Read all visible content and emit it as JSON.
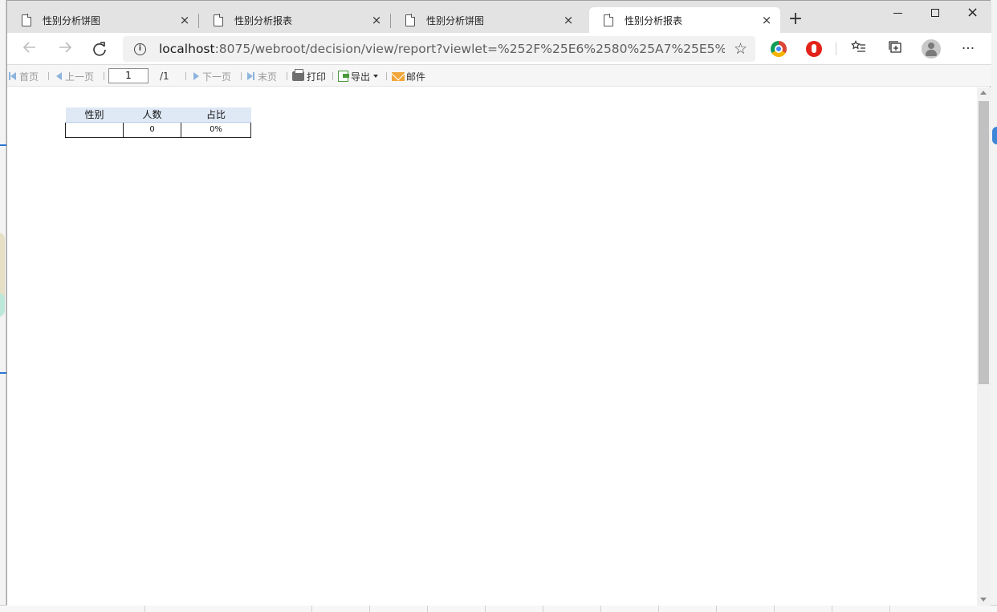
{
  "browser": {
    "tabs": [
      {
        "title": "性别分析饼图",
        "active": false
      },
      {
        "title": "性别分析报表",
        "active": false
      },
      {
        "title": "性别分析饼图",
        "active": false
      },
      {
        "title": "性别分析报表",
        "active": true
      }
    ],
    "new_tab": "+",
    "close_glyph": "×",
    "address": {
      "host": "localhost",
      "rest": ":8075/webroot/decision/view/report?viewlet=%252F%25E6%2580%25A7%25E5%2588%..."
    }
  },
  "toolbar": {
    "first": "首页",
    "prev": "上一页",
    "page_current": "1",
    "page_total": "/1",
    "next": "下一页",
    "last": "末页",
    "print": "打印",
    "export": "导出",
    "email": "邮件"
  },
  "report": {
    "headers": [
      "性别",
      "人数",
      "占比"
    ],
    "rows": [
      [
        "",
        "0",
        "0%"
      ]
    ]
  },
  "colors": {
    "header_bg": "#dfe9f5",
    "accent": "#8db4dd"
  }
}
